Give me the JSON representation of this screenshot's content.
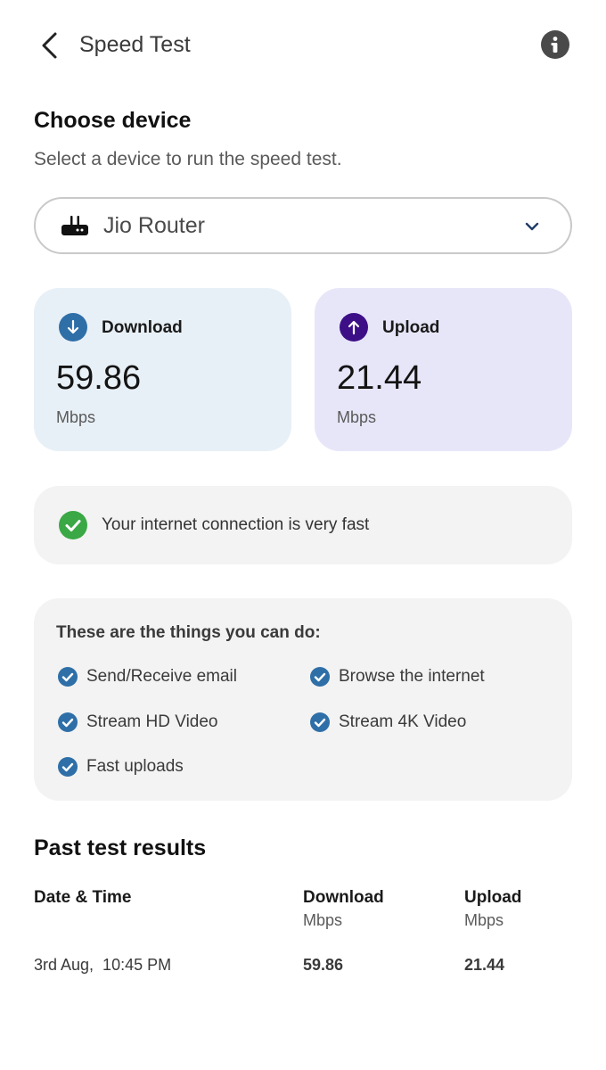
{
  "header": {
    "title": "Speed Test",
    "back_icon": "chevron-left-icon",
    "info_icon": "info-icon"
  },
  "device": {
    "heading": "Choose device",
    "subtitle": "Select a device to run the speed test.",
    "selected": "Jio Router",
    "icon": "router-icon"
  },
  "download": {
    "label": "Download",
    "value": "59.86",
    "unit": "Mbps",
    "color": "#2f6fa8",
    "bg": "#e8f0f7"
  },
  "upload": {
    "label": "Upload",
    "value": "21.44",
    "unit": "Mbps",
    "color": "#3d0f87",
    "bg": "#e7e6f9"
  },
  "status": {
    "message": "Your internet connection is very fast",
    "color": "#3aa845"
  },
  "capabilities": {
    "title": "These are the things you can do:",
    "items": [
      "Send/Receive email",
      "Browse the internet",
      "Stream HD Video",
      "Stream 4K Video",
      "Fast uploads"
    ]
  },
  "past": {
    "heading": "Past test results",
    "columns": [
      {
        "label": "Date & Time",
        "unit": ""
      },
      {
        "label": "Download",
        "unit": "Mbps"
      },
      {
        "label": "Upload",
        "unit": "Mbps"
      }
    ],
    "rows": [
      {
        "datetime": "3rd Aug,  10:45 PM",
        "download": "59.86",
        "upload": "21.44"
      }
    ]
  }
}
